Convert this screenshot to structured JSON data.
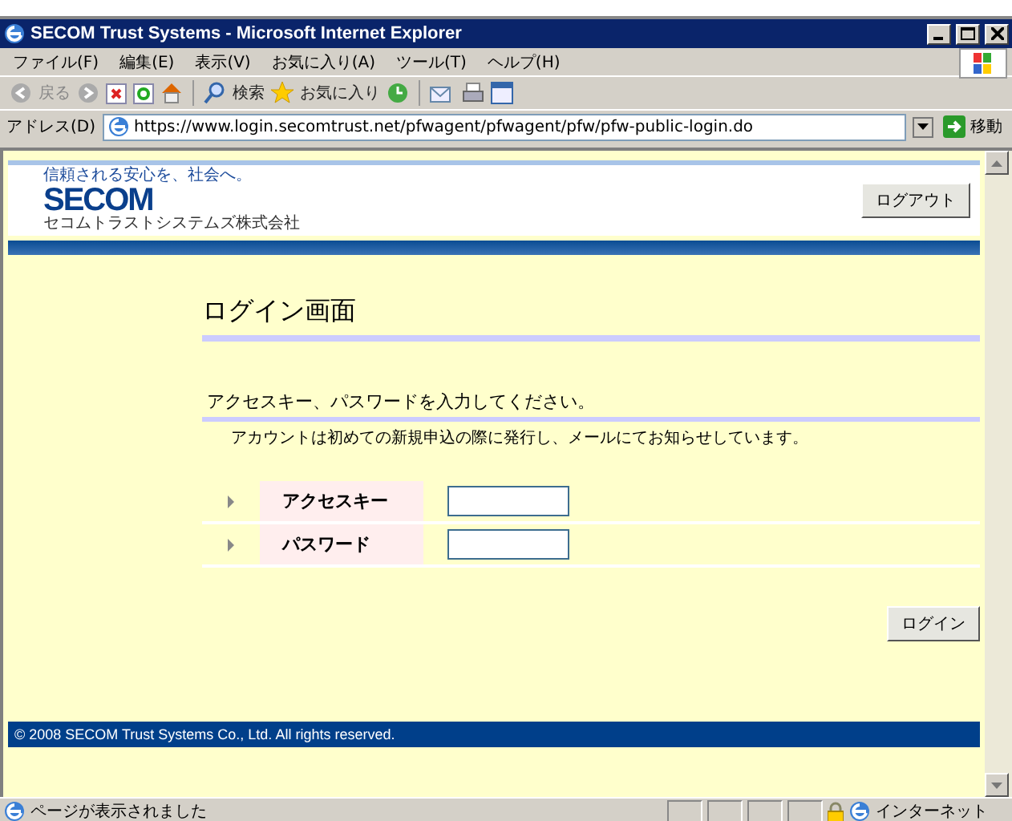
{
  "window": {
    "title": "SECOM Trust Systems - Microsoft Internet Explorer"
  },
  "menu": [
    "ファイル(F)",
    "編集(E)",
    "表示(V)",
    "お気に入り(A)",
    "ツール(T)",
    "ヘルプ(H)"
  ],
  "toolbar": {
    "back": "戻る",
    "search": "検索",
    "favorites": "お気に入り"
  },
  "address": {
    "label": "アドレス(D)",
    "url": "https://www.login.secomtrust.net/pfwagent/pfwagent/pfw/pfw-public-login.do",
    "go": "移動"
  },
  "page": {
    "logo": {
      "tagline": "信頼される安心を、社会へ。",
      "name": "SECOM",
      "company": "セコムトラストシステムズ株式会社"
    },
    "logout": "ログアウト",
    "heading": "ログイン画面",
    "instruction": "アクセスキー、パスワードを入力してください。",
    "note": "アカウントは初めての新規申込の際に発行し、メールにてお知らせしています。",
    "fields": [
      {
        "label": "アクセスキー"
      },
      {
        "label": "パスワード"
      }
    ],
    "login": "ログイン",
    "footer": "© 2008  SECOM Trust Systems Co., Ltd. All rights reserved."
  },
  "status_bar": {
    "text": "ページが表示されました",
    "zone": "インターネット"
  }
}
